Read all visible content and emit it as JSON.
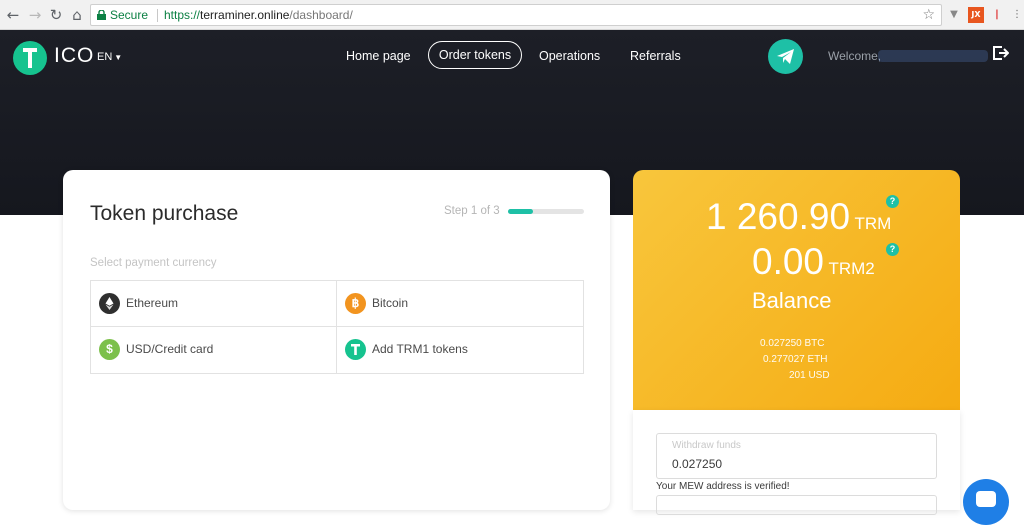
{
  "browser": {
    "secure_label": "Secure",
    "url_scheme": "https://",
    "url_host": "terraminer.online",
    "url_path": "/dashboard/",
    "ext_label": "JX"
  },
  "header": {
    "logo_text": "ICO",
    "language": "EN",
    "nav": {
      "home": "Home page",
      "order": "Order tokens",
      "operations": "Operations",
      "referrals": "Referrals"
    },
    "welcome": "Welcome,"
  },
  "purchase": {
    "title": "Token purchase",
    "step": "Step 1 of 3",
    "step_progress": 0.33,
    "select_label": "Select payment currency",
    "options": [
      {
        "label": "Ethereum",
        "icon": "ethereum-icon"
      },
      {
        "label": "Bitcoin",
        "icon": "bitcoin-icon"
      },
      {
        "label": "USD/Credit card",
        "icon": "dollar-icon"
      },
      {
        "label": "Add TRM1 tokens",
        "icon": "trm-token-icon"
      }
    ]
  },
  "balance": {
    "trm_value": "1 260.90",
    "trm_unit": "TRM",
    "trm2_value": "0.00",
    "trm2_unit": "TRM2",
    "label": "Balance",
    "btc": "0.027250 BTC",
    "eth": "0.277027 ETH",
    "usd": "201 USD",
    "help_mark": "?"
  },
  "withdraw": {
    "placeholder": "Withdraw funds",
    "value": "0.027250",
    "verified_text": "Your MEW address is verified!"
  },
  "colors": {
    "accent": "#1ec0a6",
    "brand_green": "#16c38f",
    "balance_gold": "#f5ab12",
    "header_dark": "#1b1d24",
    "chat_blue": "#1f7fe6"
  }
}
